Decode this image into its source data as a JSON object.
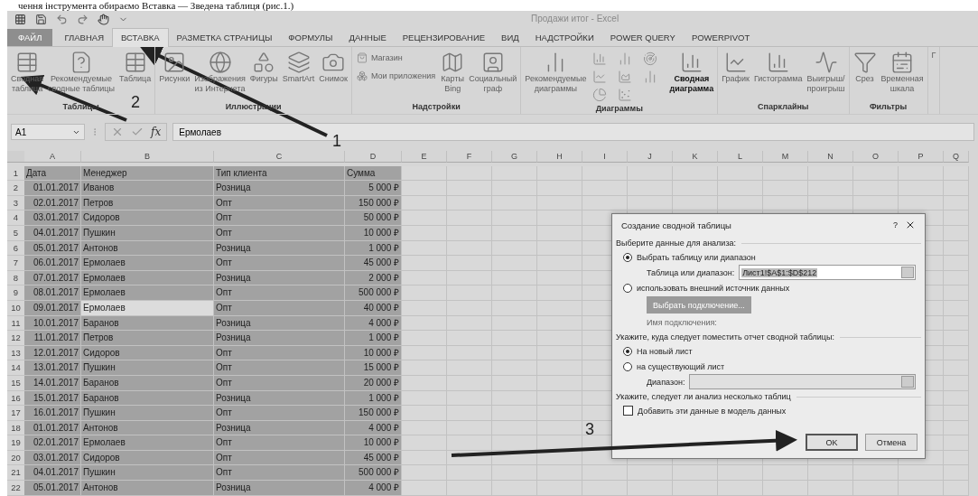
{
  "caption": "чення інструмента обираємо Вставка — Зведена таблиця (рис.1.)",
  "window": {
    "title": "Продажи итог - Excel"
  },
  "tabs": [
    {
      "label": "ФАЙЛ",
      "kind": "file",
      "selected": false
    },
    {
      "label": "ГЛАВНАЯ",
      "kind": "tab",
      "selected": false
    },
    {
      "label": "ВСТАВКА",
      "kind": "tab",
      "selected": true
    },
    {
      "label": "РАЗМЕТКА СТРАНИЦЫ",
      "kind": "tab",
      "selected": false
    },
    {
      "label": "ФОРМУЛЫ",
      "kind": "tab",
      "selected": false
    },
    {
      "label": "ДАННЫЕ",
      "kind": "tab",
      "selected": false
    },
    {
      "label": "РЕЦЕНЗИРОВАНИЕ",
      "kind": "tab",
      "selected": false
    },
    {
      "label": "ВИД",
      "kind": "tab",
      "selected": false
    },
    {
      "label": "НАДСТРОЙКИ",
      "kind": "tab",
      "selected": false
    },
    {
      "label": "POWER QUERY",
      "kind": "tab",
      "selected": false
    },
    {
      "label": "POWERPIVOT",
      "kind": "tab",
      "selected": false
    }
  ],
  "ribbon": {
    "groups": [
      {
        "label": "Таблицы",
        "buttons": [
          {
            "kind": "large",
            "label": "Сводная\nтаблица",
            "disabled": true
          },
          {
            "kind": "large",
            "label": "Рекомендуемые\nсводные таблицы",
            "disabled": true
          },
          {
            "kind": "large",
            "label": "Таблица",
            "disabled": true
          }
        ]
      },
      {
        "label": "Иллюстрации",
        "buttons": [
          {
            "kind": "large",
            "label": "Рисунки",
            "disabled": true
          },
          {
            "kind": "large",
            "label": "Изображения\nиз Интернета",
            "disabled": true
          },
          {
            "kind": "large",
            "label": "Фигуры",
            "disabled": true
          },
          {
            "kind": "large",
            "label": "SmartArt",
            "disabled": true
          },
          {
            "kind": "large",
            "label": "Снимок",
            "disabled": true
          }
        ]
      },
      {
        "label": "Надстройки",
        "buttons": [
          {
            "kind": "small",
            "label": "Магазин",
            "disabled": true
          },
          {
            "kind": "small",
            "label": "Мои приложения",
            "disabled": true
          },
          {
            "kind": "large",
            "label": "Карты\nBing",
            "disabled": true
          },
          {
            "kind": "large",
            "label": "Социальный\nграф",
            "disabled": true
          }
        ]
      },
      {
        "label": "Диаграммы",
        "buttons": [
          {
            "kind": "large",
            "label": "Рекомендуемые\nдиаграммы",
            "disabled": true
          },
          {
            "kind": "grid",
            "disabled": true
          },
          {
            "kind": "large",
            "label": "Сводная\nдиаграмма",
            "disabled": false
          }
        ]
      },
      {
        "label": "Спарклайны",
        "buttons": [
          {
            "kind": "large",
            "label": "График",
            "disabled": true
          },
          {
            "kind": "large",
            "label": "Гистограмма",
            "disabled": true
          },
          {
            "kind": "large",
            "label": "Выигрыш/\nпроигрыш",
            "disabled": true
          }
        ]
      },
      {
        "label": "Фильтры",
        "buttons": [
          {
            "kind": "large",
            "label": "Срез",
            "disabled": true
          },
          {
            "kind": "large",
            "label": "Временная\nшкала",
            "disabled": true
          }
        ]
      },
      {
        "buttons": [
          {
            "kind": "large",
            "label": "Г",
            "disabled": true
          }
        ]
      }
    ]
  },
  "formula_bar": {
    "name_box": "A1",
    "fx": "fx",
    "value": "Ермолаев"
  },
  "sheet": {
    "columns": [
      "A",
      "B",
      "C",
      "D",
      "E",
      "F",
      "G",
      "H",
      "I",
      "J",
      "K",
      "L",
      "M",
      "N",
      "O",
      "P",
      "Q"
    ],
    "rows": [
      {
        "number": "1",
        "cells": [
          "Дата",
          "Менеджер",
          "Тип клиента",
          "Сумма"
        ],
        "active": false
      },
      {
        "number": "2",
        "cells": [
          "01.01.2017",
          "Иванов",
          "Розница",
          "5 000 ₽"
        ],
        "active": false
      },
      {
        "number": "3",
        "cells": [
          "02.01.2017",
          "Петров",
          "Опт",
          "150 000 ₽"
        ],
        "active": false
      },
      {
        "number": "4",
        "cells": [
          "03.01.2017",
          "Сидоров",
          "Опт",
          "50 000 ₽"
        ],
        "active": false
      },
      {
        "number": "5",
        "cells": [
          "04.01.2017",
          "Пушкин",
          "Опт",
          "10 000 ₽"
        ],
        "active": false
      },
      {
        "number": "6",
        "cells": [
          "05.01.2017",
          "Антонов",
          "Розница",
          "1 000 ₽"
        ],
        "active": false
      },
      {
        "number": "7",
        "cells": [
          "06.01.2017",
          "Ермолаев",
          "Опт",
          "45 000 ₽"
        ],
        "active": false
      },
      {
        "number": "8",
        "cells": [
          "07.01.2017",
          "Ермолаев",
          "Розница",
          "2 000 ₽"
        ],
        "active": false
      },
      {
        "number": "9",
        "cells": [
          "08.01.2017",
          "Ермолаев",
          "Опт",
          "500 000 ₽"
        ],
        "active": false
      },
      {
        "number": "10",
        "cells": [
          "09.01.2017",
          "Ермолаев",
          "Опт",
          "40 000 ₽"
        ],
        "active": true
      },
      {
        "number": "11",
        "cells": [
          "10.01.2017",
          "Баранов",
          "Розница",
          "4 000 ₽"
        ],
        "active": false
      },
      {
        "number": "12",
        "cells": [
          "11.01.2017",
          "Петров",
          "Розница",
          "1 000 ₽"
        ],
        "active": false
      },
      {
        "number": "13",
        "cells": [
          "12.01.2017",
          "Сидоров",
          "Опт",
          "10 000 ₽"
        ],
        "active": false
      },
      {
        "number": "14",
        "cells": [
          "13.01.2017",
          "Пушкин",
          "Опт",
          "15 000 ₽"
        ],
        "active": false
      },
      {
        "number": "15",
        "cells": [
          "14.01.2017",
          "Баранов",
          "Опт",
          "20 000 ₽"
        ],
        "active": false
      },
      {
        "number": "16",
        "cells": [
          "15.01.2017",
          "Баранов",
          "Розница",
          "1 000 ₽"
        ],
        "active": false
      },
      {
        "number": "17",
        "cells": [
          "16.01.2017",
          "Пушкин",
          "Опт",
          "150 000 ₽"
        ],
        "active": false
      },
      {
        "number": "18",
        "cells": [
          "01.01.2017",
          "Антонов",
          "Розница",
          "4 000 ₽"
        ],
        "active": false
      },
      {
        "number": "19",
        "cells": [
          "02.01.2017",
          "Ермолаев",
          "Опт",
          "10 000 ₽"
        ],
        "active": false
      },
      {
        "number": "20",
        "cells": [
          "03.01.2017",
          "Сидоров",
          "Опт",
          "45 000 ₽"
        ],
        "active": false
      },
      {
        "number": "21",
        "cells": [
          "04.01.2017",
          "Пушкин",
          "Опт",
          "500 000 ₽"
        ],
        "active": false
      },
      {
        "number": "22",
        "cells": [
          "05.01.2017",
          "Антонов",
          "Розница",
          "4 000 ₽"
        ],
        "active": false
      }
    ]
  },
  "dialog": {
    "title": "Создание сводной таблицы",
    "help": "?",
    "sections": [
      {
        "heading": "Выберите данные для анализа:",
        "items": [
          {
            "kind": "radio",
            "label": "Выбрать таблицу или диапазон",
            "selected": true
          },
          {
            "kind": "field",
            "label": "Таблица или диапазон:",
            "value": "Лист1!$A$1:$D$212",
            "disabled": false
          },
          {
            "kind": "radio",
            "label": "использовать внешний источник данных",
            "selected": false
          },
          {
            "kind": "button",
            "label": "Выбрать подключение...",
            "disabled": true
          },
          {
            "kind": "note",
            "label": "Имя подключения:"
          }
        ]
      },
      {
        "heading": "Укажите, куда следует поместить отчет сводной таблицы:",
        "items": [
          {
            "kind": "radio",
            "label": "На новый лист",
            "selected": true
          },
          {
            "kind": "radio",
            "label": "на существующий лист",
            "selected": false
          },
          {
            "kind": "field",
            "label": "Диапазон:",
            "value": "",
            "disabled": true
          }
        ]
      },
      {
        "heading": "Укажите, следует ли анализ несколько таблиц",
        "items": [
          {
            "kind": "checkbox",
            "label": "Добавить эти данные в модель данных",
            "checked": false
          }
        ]
      }
    ],
    "buttons": [
      {
        "label": "OK",
        "default": true
      },
      {
        "label": "Отмена",
        "default": false
      }
    ]
  },
  "annotations": [
    {
      "label": "1"
    },
    {
      "label": "2"
    },
    {
      "label": "3"
    }
  ]
}
